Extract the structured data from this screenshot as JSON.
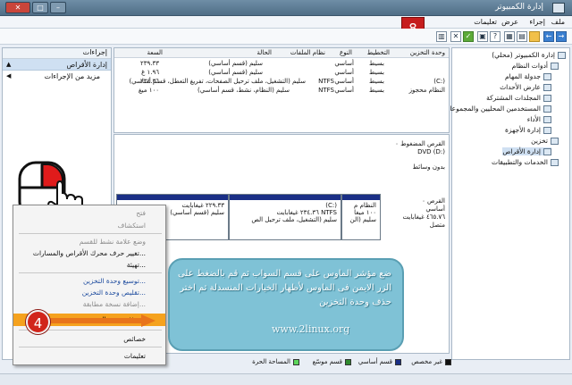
{
  "window": {
    "title": "إدارة الكمبيوتر"
  },
  "menubar": [
    "ملف",
    "إجراء",
    "عرض",
    "تعليمات"
  ],
  "step_badges": {
    "top": "8",
    "menu": "4"
  },
  "tree": {
    "items": [
      "إدارة الكمبيوتر (محلي)",
      "أدوات النظام",
      "جدولة المهام",
      "عارض الأحداث",
      "المجلدات المشتركة",
      "المستخدمين المحليين والمجموعات",
      "الأداء",
      "إدارة الأجهزة",
      "تخزين",
      "إدارة الأقراص",
      "الخدمات والتطبيقات"
    ]
  },
  "actions_pane": {
    "header": "إجراءات",
    "selected": "إدارة الأقراص",
    "more": "مزيد من الإجراءات"
  },
  "volume_list": {
    "columns": [
      "وحدة التخزين",
      "التخطيط",
      "النوع",
      "نظام الملفات",
      "الحالة",
      "السعة",
      "المساحة الحرة"
    ],
    "rows": [
      {
        "volume": "",
        "layout": "بسيط",
        "type": "أساسي",
        "fs": "",
        "status": "سليم (قسم أساسي)",
        "capacity": "٢٣٩.٣٣"
      },
      {
        "volume": "",
        "layout": "بسيط",
        "type": "أساسي",
        "fs": "",
        "status": "سليم (قسم أساسي)",
        "capacity": "١.٩٦ غ"
      },
      {
        "volume": "(C:)",
        "layout": "بسيط",
        "type": "أساسي",
        "fs": "NTFS",
        "status": "سليم (التشغيل، ملف ترحيل الصفحات، تفريغ التعطل، قسم أساسي)",
        "capacity": "٢٣٤.٣٦"
      },
      {
        "volume": "النظام محجوز",
        "layout": "بسيط",
        "type": "أساسي",
        "fs": "NTFS",
        "status": "سليم (النظام، نشط، قسم أساسي)",
        "capacity": "١٠٠ ميغ"
      }
    ]
  },
  "disk_area": {
    "cdrom": {
      "label": "القرص المضغوط ٠",
      "type": "DVD (D:)",
      "media": "بدون وسائط"
    },
    "disk0": {
      "label": "القرص ٠",
      "type": "أساسي",
      "size": "٤٦٥.٧٦ غيغابايت",
      "state": "متصل"
    },
    "partitions": [
      {
        "name": "النظام م",
        "size": "١٠٠ ميغا",
        "status": "سليم (الن"
      },
      {
        "name": "(C:)",
        "size": "٢٣٤.٣٦ غيغابايت NTFS",
        "status": "سليم (التشغيل، ملف ترحيل الص"
      },
      {
        "name": "",
        "size": "٢٢٩.٣٣ غيغابايت",
        "status": "سليم (قسم أساسي)"
      }
    ]
  },
  "context_menu": {
    "items": [
      "فتح",
      "استكشاف",
      "وضع علامة نشط للقسم",
      "تغيير حرف محرك الأقراص والمسارات...",
      "تهيئة...",
      "توسيع وحدة التخزين...",
      "تقليص وحدة التخزين...",
      "إضافة نسخة مطابقة...",
      "حذف وحدة التخزين...",
      "خصائص",
      "تعليمات"
    ]
  },
  "callout": {
    "text": "ضع مؤشر الماوس على قسم السواب ثم قم بالضغط على الزر الايمن فى الماوس لأظهار الخيارات المنسدلة ثم اختر حذف وحدة التخزين"
  },
  "watermark": "www.2linux.org",
  "legend": [
    {
      "label": "غير مخصص",
      "color": "#111111"
    },
    {
      "label": "قسم أساسي",
      "color": "#1a2f86"
    },
    {
      "label": "قسم موسّع",
      "color": "#2f8a2f"
    },
    {
      "label": "المساحة الحرة",
      "color": "#5cd65c"
    }
  ]
}
